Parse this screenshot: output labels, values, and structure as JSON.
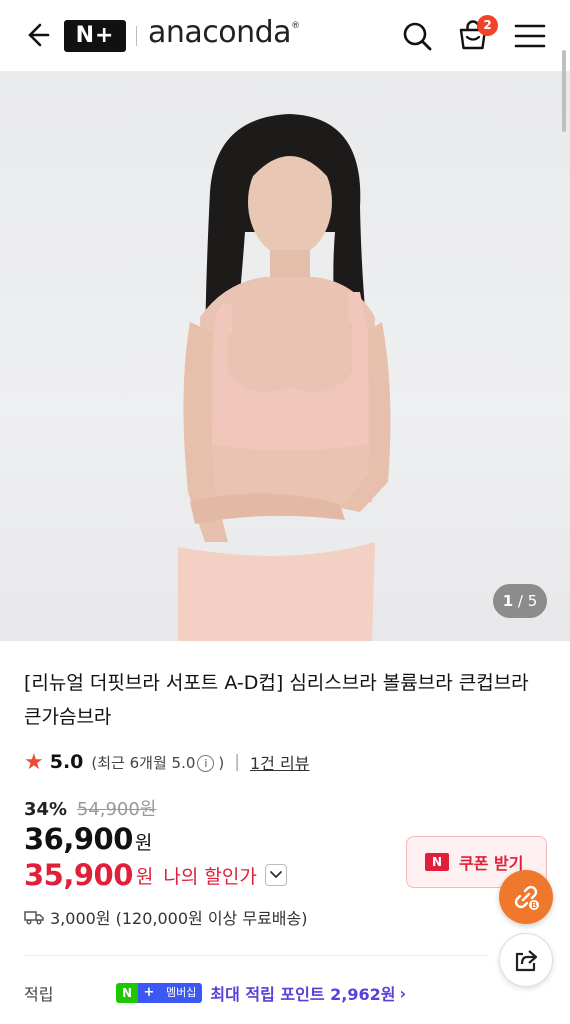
{
  "header": {
    "back_icon": "back-arrow-icon",
    "nplus_logo": "N+",
    "brand_name": "anaconda",
    "brand_mark": "®",
    "search_icon": "search-icon",
    "cart_icon": "shopping-bag-icon",
    "cart_count": "2",
    "menu_icon": "hamburger-menu-icon"
  },
  "gallery": {
    "current": "1",
    "separator": "/",
    "total": "5"
  },
  "product": {
    "title": "[리뉴얼 더핏브라 서포트 A-D컵] 심리스브라 볼륨브라 큰컵브라 큰가슴브라",
    "rating": {
      "score": "5.0",
      "recent_prefix": "(최근 6개월 5.0",
      "recent_suffix": ")",
      "divider": "|",
      "review_link": "1건 리뷰"
    },
    "discount_rate": "34%",
    "original_price": "54,900원",
    "price": "36,900",
    "price_unit": "원",
    "my_price": "35,900",
    "my_price_unit": "원",
    "my_price_label": "나의 할인가",
    "shipping": "3,000원 (120,000원 이상 무료배송)"
  },
  "coupon": {
    "logo": "N",
    "label": "쿠폰 받기"
  },
  "points": {
    "label": "적립",
    "badge_n": "N",
    "badge_plus": "+",
    "badge_member": "멤버십",
    "text": "최대 적립 포인트 2,962원",
    "arrow": "›"
  },
  "colors": {
    "accent_red": "#e0203a",
    "star": "#f04b2e",
    "fab_orange": "#f0782d",
    "points_purple": "#5a3fd8",
    "naver_green": "#1ec800"
  }
}
